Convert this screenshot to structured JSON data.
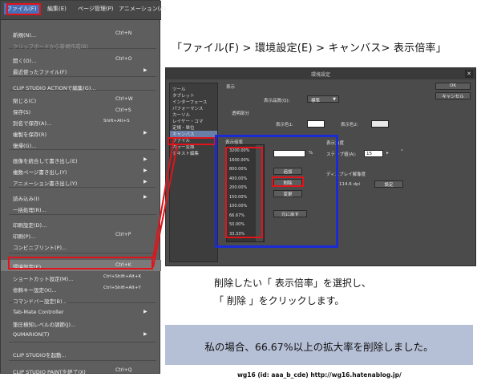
{
  "colors": {
    "highlight_red": "#e1141b",
    "highlight_blue": "#1a2bd6",
    "note_background": "#b5bfd6"
  },
  "menubar": {
    "items": [
      "ファイル(F)",
      "編集(E)",
      "ページ管理(P)",
      "アニメーション(A)"
    ],
    "active_index": 0
  },
  "file_menu": {
    "items": [
      {
        "label": "新規(N)...",
        "shortcut": "Ctrl+N"
      },
      {
        "label": "クリップボードから新規作成(B)",
        "shortcut": "",
        "disabled": true
      },
      {
        "label": "開く(O)...",
        "shortcut": "Ctrl+O"
      },
      {
        "label": "最近使ったファイル(F)",
        "shortcut": "",
        "submenu": true
      },
      {
        "label": "CLIP STUDIO ACTIONで編集(G)...",
        "shortcut": ""
      },
      {
        "label": "閉じる(C)",
        "shortcut": "Ctrl+W"
      },
      {
        "label": "保存(S)",
        "shortcut": "Ctrl+S"
      },
      {
        "label": "別名で保存(A)...",
        "shortcut": "Shift+Alt+S"
      },
      {
        "label": "複製を保存(R)",
        "shortcut": "",
        "submenu": true
      },
      {
        "label": "復帰(G)...",
        "shortcut": ""
      },
      {
        "label": "画像を統合して書き出し(E)",
        "shortcut": "",
        "submenu": true
      },
      {
        "label": "複数ページ書き出し(Y)",
        "shortcut": "",
        "submenu": true
      },
      {
        "label": "アニメーション書き出し(Y)",
        "shortcut": "",
        "submenu": true
      },
      {
        "label": "読み込み(I)",
        "shortcut": "",
        "submenu": true
      },
      {
        "label": "一括処理(R)...",
        "shortcut": ""
      },
      {
        "label": "印刷設定(D)...",
        "shortcut": ""
      },
      {
        "label": "印刷(P)...",
        "shortcut": "Ctrl+P"
      },
      {
        "label": "コンビニプリント(P)...",
        "shortcut": ""
      },
      {
        "label": "環境設定(E)...",
        "shortcut": "Ctrl+K",
        "highlighted": true
      },
      {
        "label": "ショートカット設定(M)...",
        "shortcut": "Ctrl+Shift+Alt+K"
      },
      {
        "label": "修飾キー設定(X)...",
        "shortcut": "Ctrl+Shift+Alt+Y"
      },
      {
        "label": "コマンドバー設定(B)...",
        "shortcut": ""
      },
      {
        "label": "Tab-Mate Controller",
        "shortcut": "",
        "submenu": true
      },
      {
        "label": "筆圧検知レベルの調節(J)...",
        "shortcut": ""
      },
      {
        "label": "QUMARION(T)",
        "shortcut": "",
        "submenu": true
      },
      {
        "label": "CLIP STUDIOを起動...",
        "shortcut": ""
      },
      {
        "label": "CLIP STUDIO PAINTを終了(X)",
        "shortcut": "Ctrl+Q"
      }
    ]
  },
  "breadcrumb": "「ファイル(F) > 環境設定(E) > キャンバス> 表示倍率」",
  "dialog": {
    "title": "環境設定",
    "close_glyph": "✕",
    "ok_label": "OK",
    "cancel_label": "キャンセル",
    "categories": [
      "ツール",
      "タブレット",
      "インターフェース",
      "パフォーマンス",
      "カーソル",
      "レイヤー・コマ",
      "定規・単位",
      "キャンバス",
      "ファイル",
      "カラー変換",
      "テキスト編集"
    ],
    "selected_category_index": 7,
    "display_section": "表示",
    "quality_label": "表示品質(Q):",
    "quality_value": "標準",
    "transparent_label": "透明部分",
    "color1_label": "表示色1:",
    "color2_label": "表示色2:",
    "zoom_section": "表示倍率",
    "zoom_levels": [
      "3200.00%",
      "1600.00%",
      "800.00%",
      "400.00%",
      "200.00%",
      "150.00%",
      "100.00%",
      "66.67%",
      "50.00%",
      "33.33%"
    ],
    "zoom_unit": "%",
    "add_label": "追加",
    "delete_label": "削除",
    "change_label": "変更",
    "reset_label": "元に戻す",
    "angle_section": "表示角度",
    "step_label": "ステップ値(A):",
    "step_value": "15",
    "degree_unit": "°",
    "resolution_section": "ディスプレイ解像度",
    "resolution_value": "114.6 dpi",
    "settings_label": "設定"
  },
  "instructions": {
    "line1": "削除したい「 表示倍率」を選択し、",
    "line2": "「 削除 」をクリックします。"
  },
  "note": "私の場合、66.67%以上の拡大率を削除しました。",
  "watermark": "wg16 (id: aaa_b_cde) http://wg16.hatenablog.jp/"
}
